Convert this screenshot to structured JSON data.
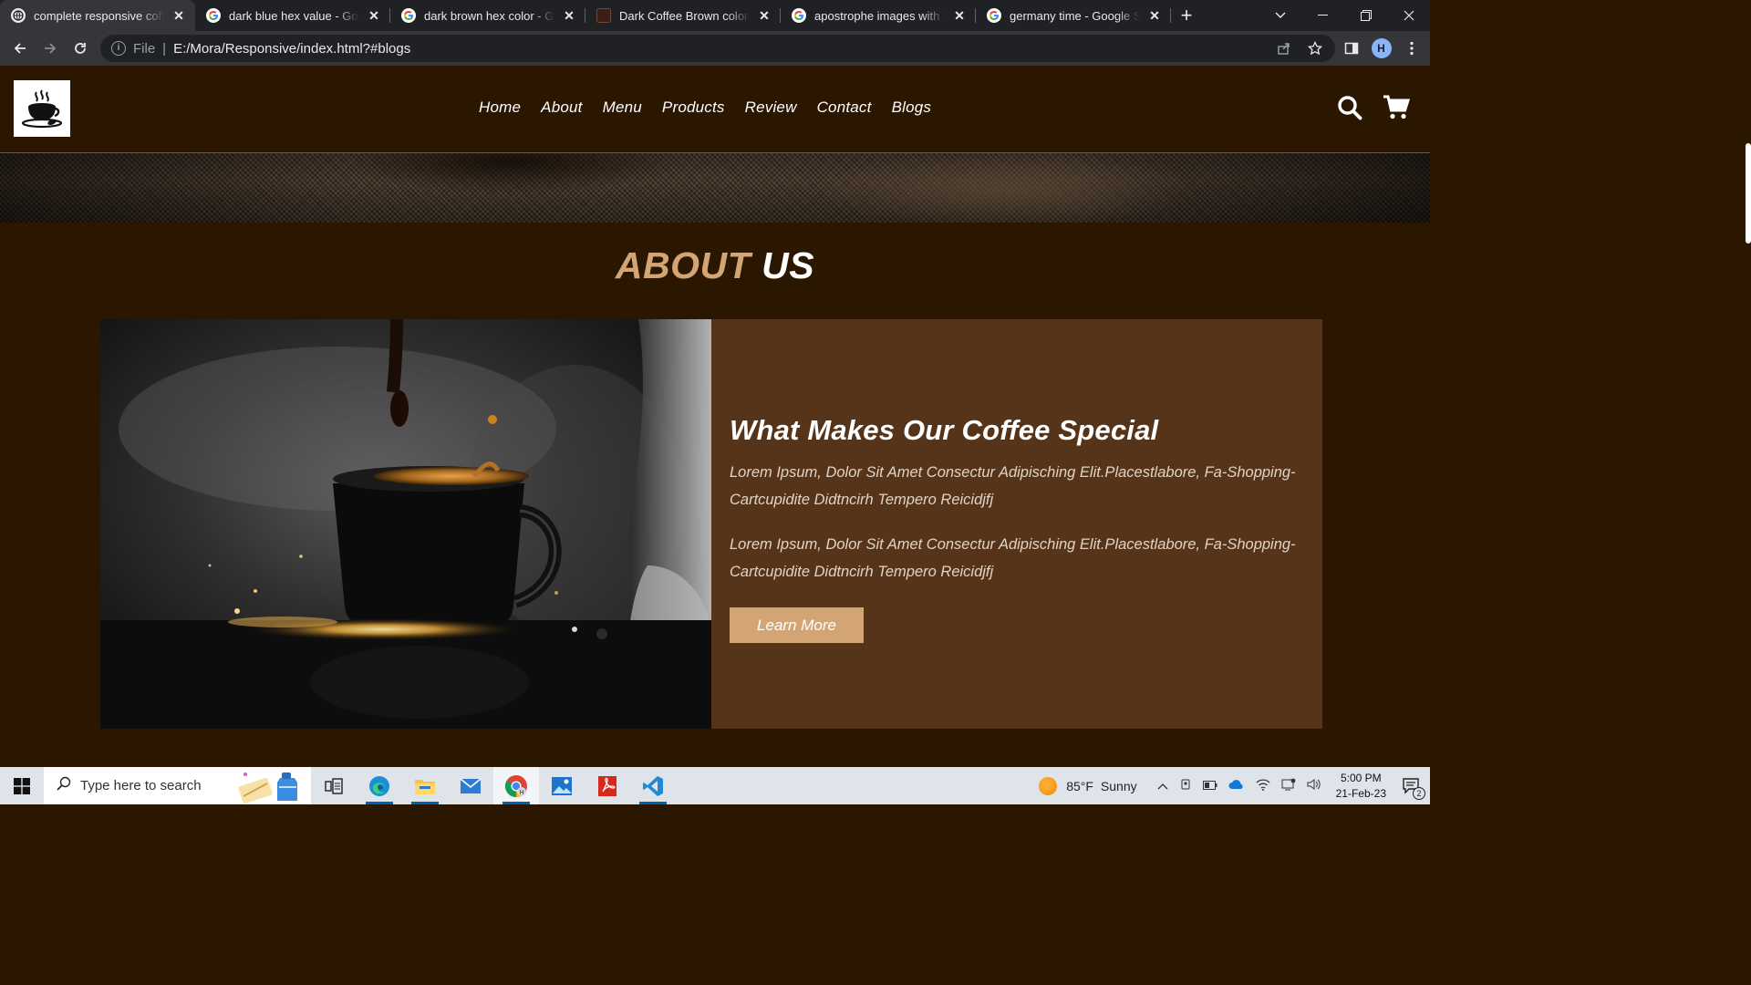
{
  "browser": {
    "tabs": [
      {
        "title": "complete responsive coffee",
        "active": true,
        "favicon": "globe-icon"
      },
      {
        "title": "dark blue hex value - Google",
        "active": false,
        "favicon": "google-icon"
      },
      {
        "title": "dark brown hex color - Google",
        "active": false,
        "favicon": "google-icon"
      },
      {
        "title": "Dark Coffee Brown color hex",
        "active": false,
        "favicon": "coffee-swatch-icon"
      },
      {
        "title": "apostrophe images with bu",
        "active": false,
        "favicon": "google-icon"
      },
      {
        "title": "germany time - Google Sea",
        "active": false,
        "favicon": "google-icon"
      }
    ],
    "address": {
      "scheme": "File",
      "url": "E:/Mora/Responsive/index.html?#blogs"
    },
    "profile_initial": "H"
  },
  "site": {
    "nav": [
      "Home",
      "About",
      "Menu",
      "Products",
      "Review",
      "Contact",
      "Blogs"
    ],
    "section_title_accent": "ABOUT",
    "section_title_rest": "US",
    "about": {
      "heading": "What Makes Our Coffee Special",
      "paragraphs": [
        "Lorem Ipsum, Dolor Sit Amet Consectur Adipisching Elit.Placestlabore, Fa-Shopping-Cartcupidite Didtncirh Tempero Reicidjfj",
        "Lorem Ipsum, Dolor Sit Amet Consectur Adipisching Elit.Placestlabore, Fa-Shopping-Cartcupidite Didtncirh Tempero Reicidjfj"
      ],
      "button": "Learn More"
    },
    "colors": {
      "background": "#2b1600",
      "accent": "#d3a574",
      "content_panel": "#55341a"
    }
  },
  "taskbar": {
    "search_placeholder": "Type here to search",
    "weather": {
      "temp": "85°F",
      "condition": "Sunny"
    },
    "clock": {
      "time": "5:00 PM",
      "date": "21-Feb-23"
    },
    "notifications": "2",
    "apps": [
      "task-view-icon",
      "edge-icon",
      "file-explorer-icon",
      "mail-icon",
      "chrome-icon",
      "photos-icon",
      "acrobat-icon",
      "vscode-icon"
    ]
  }
}
